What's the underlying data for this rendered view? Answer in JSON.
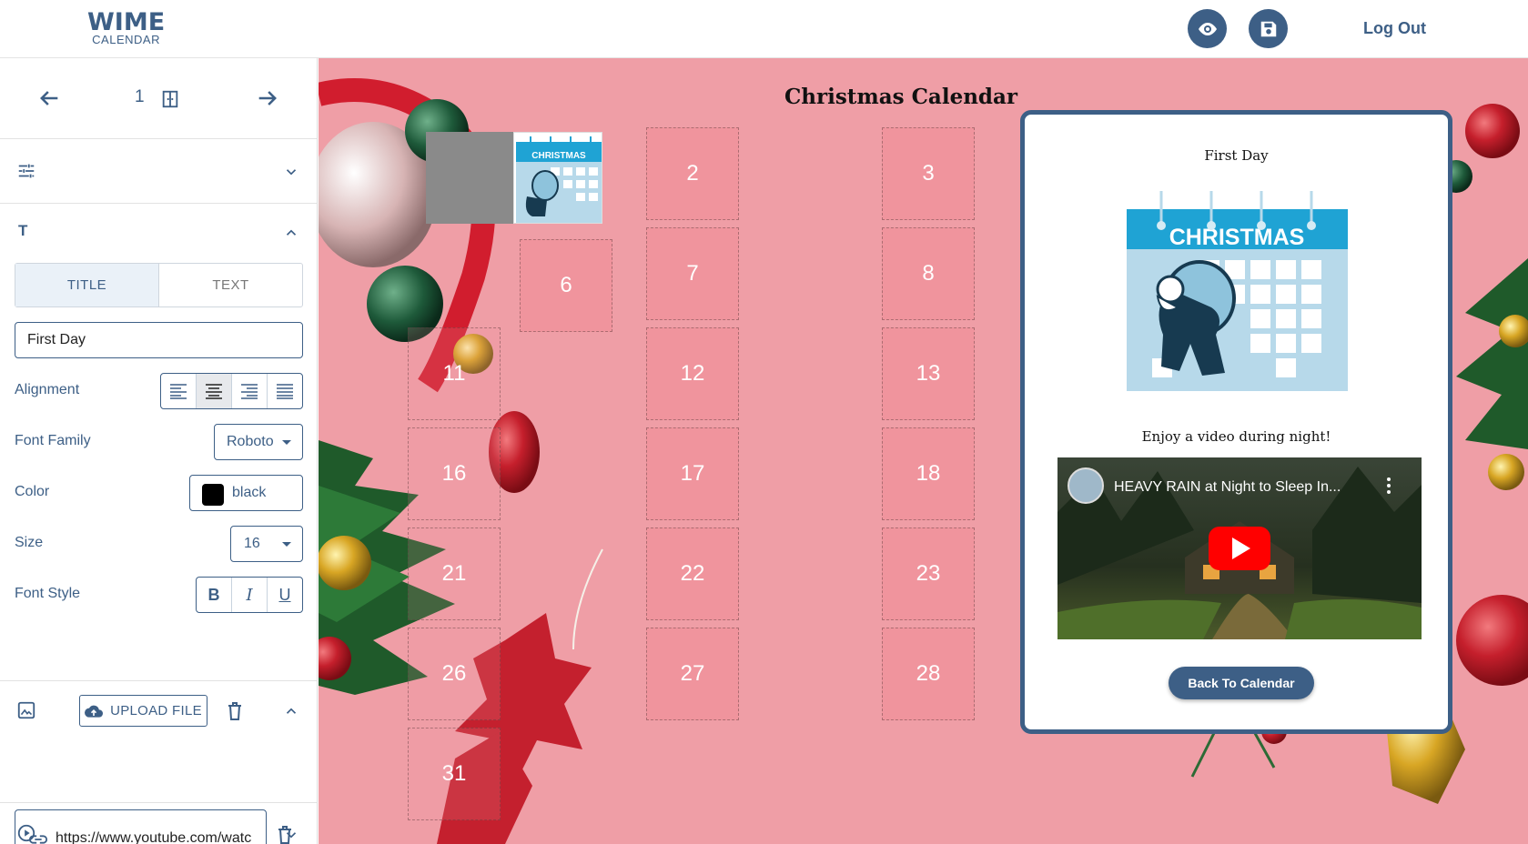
{
  "header": {
    "logo_line1": "WIME",
    "logo_line2": "CALENDAR",
    "preview_icon": "eye-icon",
    "save_icon": "save-icon",
    "logout_label": "Log Out"
  },
  "sidebar": {
    "nav": {
      "day_number": "1",
      "prev_icon": "arrow-left-icon",
      "next_icon": "arrow-right-icon",
      "door_icon": "door-icon"
    },
    "settings_section": {
      "icon": "sliders-icon",
      "expanded": false
    },
    "text_section": {
      "icon_label": "T",
      "expanded": true,
      "tabs": [
        "TITLE",
        "TEXT"
      ],
      "active_tab": "TITLE",
      "title_value": "First Day",
      "alignment_label": "Alignment",
      "alignment_selected": "center",
      "font_family_label": "Font Family",
      "font_family_value": "Roboto",
      "color_label": "Color",
      "color_value": "black",
      "color_swatch": "#000000",
      "size_label": "Size",
      "size_value": "16",
      "font_style_label": "Font Style",
      "font_styles": [
        "B",
        "I",
        "U"
      ]
    },
    "image_section": {
      "icon": "image-icon",
      "expanded": true,
      "upload_label": "UPLOAD FILE"
    },
    "video_section": {
      "icon": "play-circle-icon",
      "expanded": false,
      "url_value": "https://www.youtube.com/watc"
    }
  },
  "canvas": {
    "title": "Christmas Calendar",
    "cells": [
      "2",
      "3",
      "6",
      "7",
      "8",
      "11",
      "12",
      "13",
      "16",
      "17",
      "18",
      "21",
      "22",
      "23",
      "26",
      "27",
      "28",
      "31"
    ]
  },
  "modal": {
    "title": "First Day",
    "image_caption": "CHRISTMAS",
    "text": "Enjoy a video during night!",
    "video_title": "HEAVY RAIN at Night to Sleep In...",
    "back_label": "Back To Calendar"
  },
  "colors": {
    "primary": "#3d5f86",
    "canvas_bg": "#ef9ea6",
    "youtube_red": "#ff0000",
    "calendar_blue": "#1fa3d4"
  }
}
